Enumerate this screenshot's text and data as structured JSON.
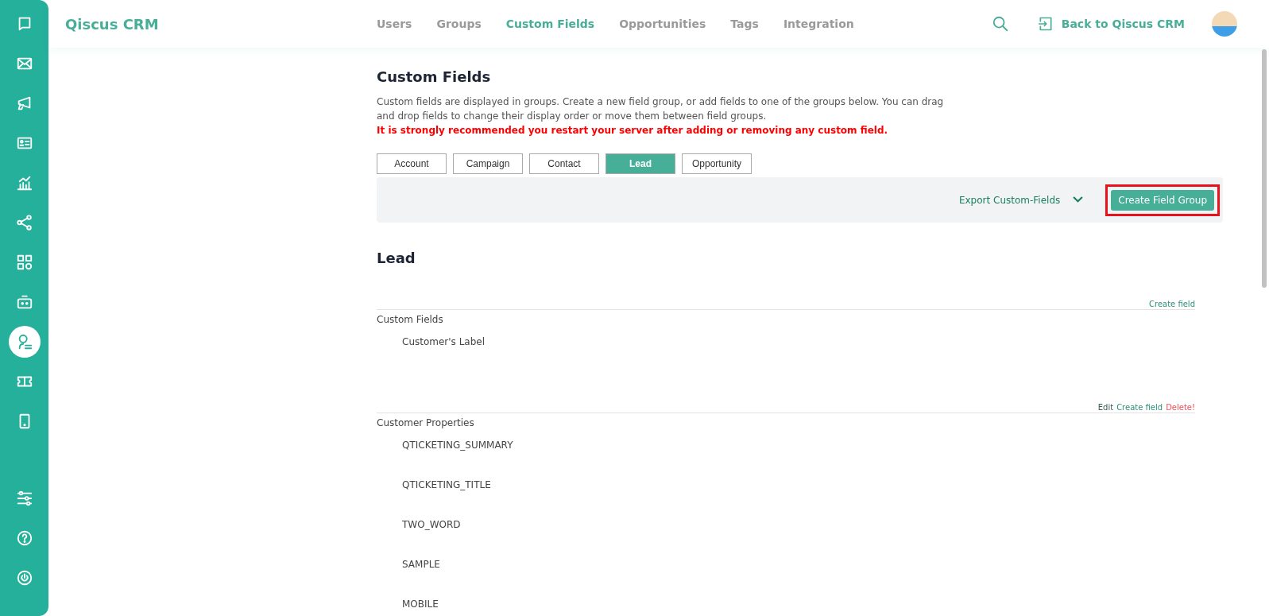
{
  "sidebar": {
    "items": [
      {
        "kind": "chat",
        "selected": false
      },
      {
        "kind": "mail",
        "selected": false
      },
      {
        "kind": "megaphone",
        "selected": false
      },
      {
        "kind": "card",
        "selected": false
      },
      {
        "kind": "chart",
        "selected": false
      },
      {
        "kind": "share",
        "selected": false
      },
      {
        "kind": "apps",
        "selected": false
      },
      {
        "kind": "bot",
        "selected": false
      },
      {
        "kind": "agent",
        "selected": true
      },
      {
        "kind": "ticket",
        "selected": false
      },
      {
        "kind": "tablet",
        "selected": false
      }
    ],
    "bottom_items": [
      {
        "kind": "sliders"
      },
      {
        "kind": "help"
      },
      {
        "kind": "power"
      }
    ]
  },
  "header": {
    "brand": "Qiscus CRM",
    "nav": [
      {
        "label": "Users",
        "selected": false
      },
      {
        "label": "Groups",
        "selected": false
      },
      {
        "label": "Custom Fields",
        "selected": true
      },
      {
        "label": "Opportunities",
        "selected": false
      },
      {
        "label": "Tags",
        "selected": false
      },
      {
        "label": "Integration",
        "selected": false
      }
    ],
    "back_link": "Back to Qiscus CRM"
  },
  "page": {
    "title": "Custom Fields",
    "description": "Custom fields are displayed in groups. Create a new field group, or add fields to one of the groups below. You can drag and drop fields to change their display order or move them between field groups.",
    "warning": "It is strongly recommended you restart your server after adding or removing any custom field.",
    "tabs": [
      {
        "label": "Account",
        "selected": false
      },
      {
        "label": "Campaign",
        "selected": false
      },
      {
        "label": "Contact",
        "selected": false
      },
      {
        "label": "Lead",
        "selected": true
      },
      {
        "label": "Opportunity",
        "selected": false
      }
    ],
    "toolbar": {
      "export": "Export Custom-Fields",
      "create_button": "Create Field Group",
      "highlighted": true
    },
    "section_title": "Lead",
    "groups": [
      {
        "name": "Custom Fields",
        "actions": [
          {
            "label": "Create field",
            "kind": "create"
          }
        ],
        "fields": [
          "Customer's Label"
        ]
      },
      {
        "name": "Customer Properties",
        "actions": [
          {
            "label": "Edit",
            "kind": "edit"
          },
          {
            "label": "Create field",
            "kind": "create"
          },
          {
            "label": "Delete!",
            "kind": "delete"
          }
        ],
        "fields": [
          "QTICKETING_SUMMARY",
          "QTICKETING_TITLE",
          "TWO_WORD",
          "SAMPLE",
          "MOBILE"
        ]
      }
    ]
  }
}
